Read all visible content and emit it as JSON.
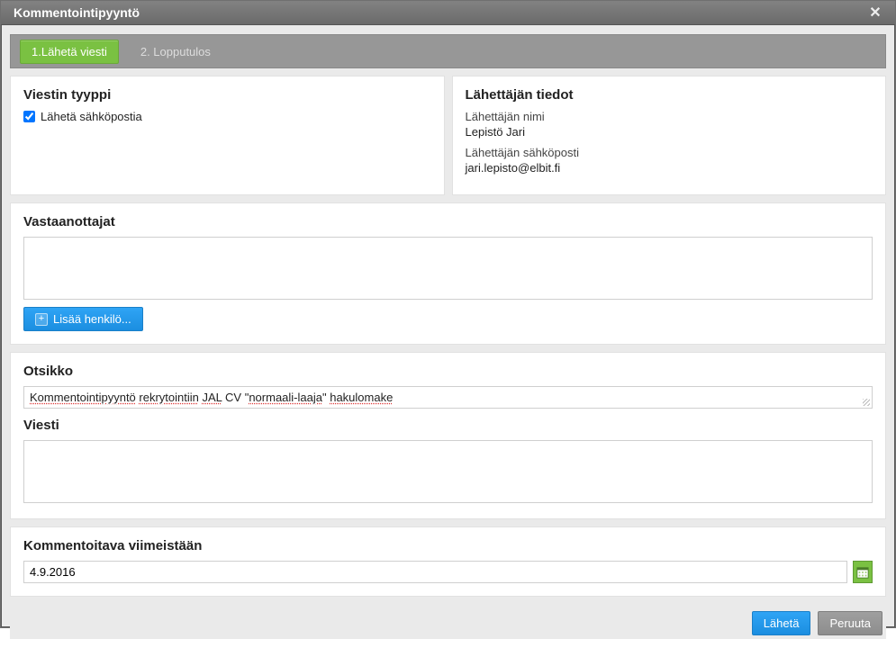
{
  "dialog": {
    "title": "Kommentointipyyntö",
    "close_label": "✕"
  },
  "tabs": {
    "active": "1.Lähetä viesti",
    "inactive": "2. Lopputulos"
  },
  "message_type": {
    "heading": "Viestin tyyppi",
    "send_email_label": "Lähetä sähköpostia",
    "send_email_checked": true
  },
  "sender": {
    "heading": "Lähettäjän tiedot",
    "name_label": "Lähettäjän nimi",
    "name_value": "Lepistö Jari",
    "email_label": "Lähettäjän sähköposti",
    "email_value": "jari.lepisto@elbit.fi"
  },
  "recipients": {
    "heading": "Vastaanottajat",
    "value": "",
    "add_button": "Lisää henkilö..."
  },
  "subject": {
    "heading": "Otsikko",
    "plain_value": "Kommentointipyyntö rekrytointiin JAL CV \"normaali-laaja\" hakulomake",
    "tokens": [
      {
        "t": "Kommentointipyyntö",
        "misspell": true
      },
      {
        "t": " ",
        "misspell": false
      },
      {
        "t": "rekrytointiin",
        "misspell": true
      },
      {
        "t": " ",
        "misspell": false
      },
      {
        "t": "JAL",
        "misspell": true
      },
      {
        "t": " CV \"",
        "misspell": false
      },
      {
        "t": "normaali-laaja",
        "misspell": true
      },
      {
        "t": "\" ",
        "misspell": false
      },
      {
        "t": "hakulomake",
        "misspell": true
      }
    ]
  },
  "message": {
    "heading": "Viesti",
    "value": ""
  },
  "deadline": {
    "heading": "Kommentoitava viimeistään",
    "value": "4.9.2016"
  },
  "footer": {
    "send": "Lähetä",
    "cancel": "Peruuta"
  }
}
